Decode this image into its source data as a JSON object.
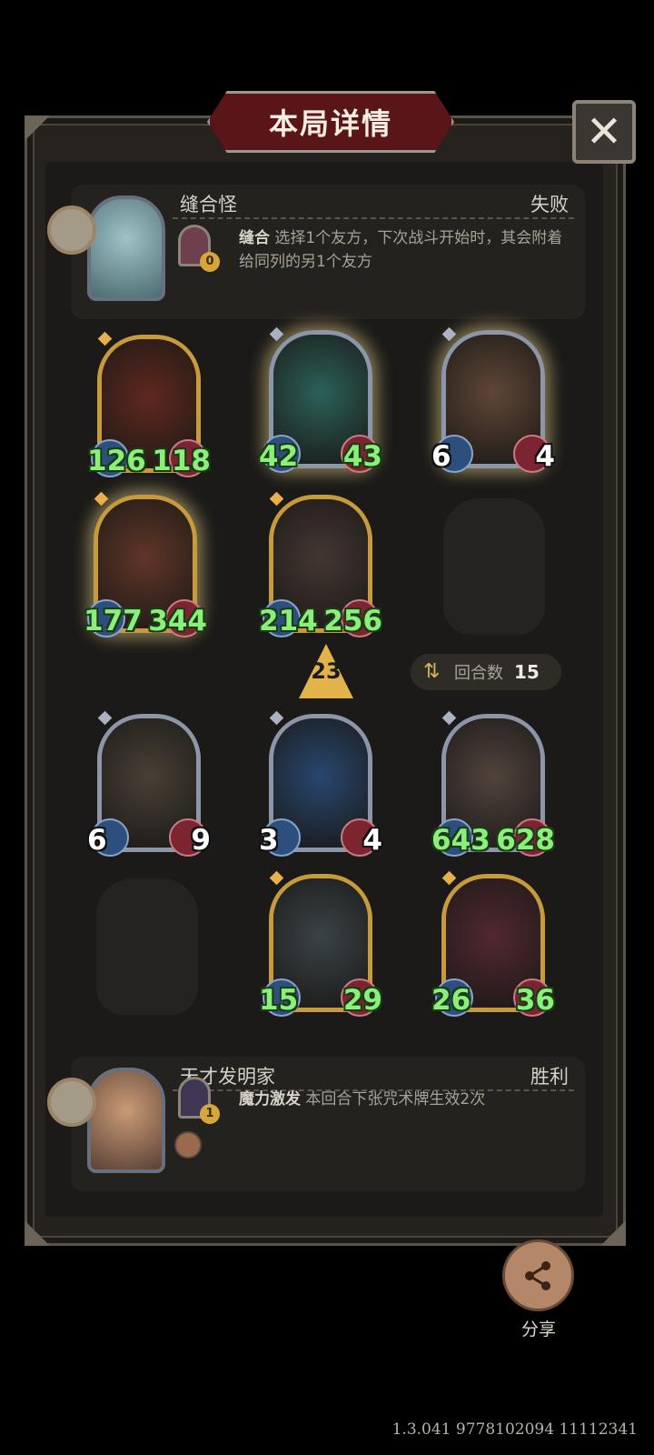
{
  "title": "本局详情",
  "close_icon": "close-icon",
  "top_hero": {
    "name": "缝合怪",
    "result": "失败",
    "power_name": "缝合",
    "power_desc": "选择1个友方，下次战斗开始时，其会附着给同列的另1个友方",
    "power_cost": "0"
  },
  "bottom_hero": {
    "name": "天才发明家",
    "result": "胜利",
    "power_name": "魔力激发",
    "power_desc": "本回合下张咒术牌生效2次",
    "power_cost": "1"
  },
  "turn": {
    "tier_number": "23",
    "rounds_label": "回合数",
    "rounds_value": "15"
  },
  "opponent_board": [
    {
      "atk": "126",
      "hp": "118",
      "buffed": true
    },
    {
      "atk": "42",
      "hp": "43",
      "buffed": true
    },
    {
      "atk": "6",
      "hp": "4",
      "buffed": false
    },
    {
      "atk": "177",
      "hp": "344",
      "buffed": true
    },
    {
      "atk": "214",
      "hp": "256",
      "buffed": true
    }
  ],
  "player_board": [
    {
      "atk": "6",
      "hp": "9",
      "buffed": false
    },
    {
      "atk": "3",
      "hp": "4",
      "buffed": false
    },
    {
      "atk": "643",
      "hp": "628",
      "buffed": true
    },
    {
      "atk": "15",
      "hp": "29",
      "buffed": true
    },
    {
      "atk": "26",
      "hp": "36",
      "buffed": true
    }
  ],
  "share_label": "分享",
  "version": "1.3.041 9778102094 11112341"
}
